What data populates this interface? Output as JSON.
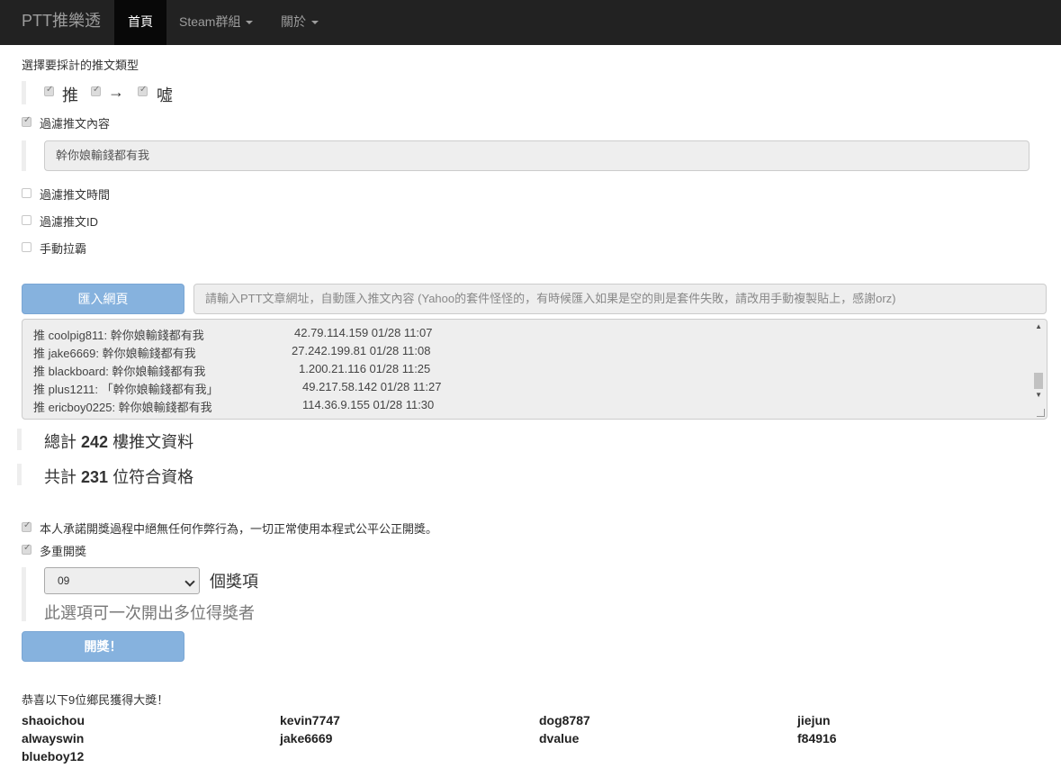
{
  "navbar": {
    "brand": "PTT推樂透",
    "items": [
      {
        "label": "首頁",
        "active": true
      },
      {
        "label": "Steam群組",
        "dropdown": true
      },
      {
        "label": "關於",
        "dropdown": true
      }
    ]
  },
  "push_type": {
    "title": "選擇要採計的推文類型",
    "push": {
      "label": "推",
      "checked": true
    },
    "arrow": {
      "label": "→",
      "checked": true
    },
    "boo": {
      "label": "噓",
      "checked": true
    }
  },
  "filter_content": {
    "label": "過濾推文內容",
    "checked": true,
    "value": "幹你娘輸錢都有我"
  },
  "filter_time": {
    "label": "過濾推文時間",
    "checked": false
  },
  "filter_id": {
    "label": "過濾推文ID",
    "checked": false
  },
  "manual_filter": {
    "label": "手動拉霸",
    "checked": false
  },
  "import": {
    "button_label": "匯入網頁",
    "url_placeholder": "請輸入PTT文章網址，自動匯入推文內容 (Yahoo的套件怪怪的，有時候匯入如果是空的則是套件失敗，請改用手動複製貼上，感謝orz)"
  },
  "pushes": [
    {
      "text": "推 coolpig811: 幹你娘輸錢都有我",
      "meta": "42.79.114.159 01/28 11:07"
    },
    {
      "text": "推 jake6669: 幹你娘輸錢都有我",
      "meta": "27.242.199.81 01/28 11:08"
    },
    {
      "text": "推 blackboard: 幹你娘輸錢都有我",
      "meta": "1.200.21.116 01/28 11:25"
    },
    {
      "text": "推 plus1211: 「幹你娘輸錢都有我」",
      "meta": "49.217.58.142 01/28 11:27"
    },
    {
      "text": "推 ericboy0225: 幹你娘輸錢都有我",
      "meta": "114.36.9.155 01/28 11:30"
    }
  ],
  "stats": {
    "total_prefix": "總計",
    "total_count": "242",
    "total_suffix": "樓推文資料",
    "qualified_prefix": "共計",
    "qualified_count": "231",
    "qualified_suffix": "位符合資格"
  },
  "promise": {
    "label": "本人承諾開獎過程中絕無任何作弊行為，一切正常使用本程式公平公正開獎。",
    "checked": true
  },
  "multi_draw": {
    "label": "多重開獎",
    "checked": true,
    "selected": "09",
    "unit": "個獎項",
    "hint": "此選項可一次開出多位得獎者"
  },
  "draw_button": "開獎！",
  "result": {
    "title": "恭喜以下9位鄉民獲得大獎！",
    "winners": [
      "shaoichou",
      "kevin7747",
      "dog8787",
      "jiejun",
      "alwayswin",
      "jake6669",
      "dvalue",
      "f84916",
      "blueboy12"
    ]
  }
}
